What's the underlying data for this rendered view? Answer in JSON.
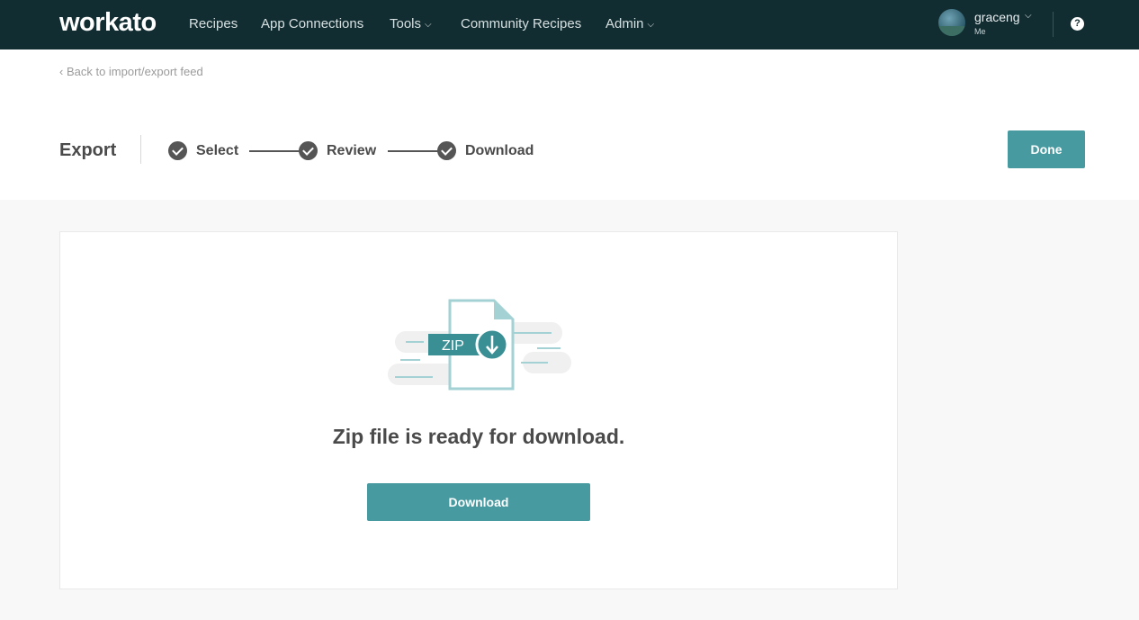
{
  "nav": {
    "logo": "workato",
    "items": [
      {
        "label": "Recipes"
      },
      {
        "label": "App Connections"
      },
      {
        "label": "Tools",
        "has_menu": true
      },
      {
        "label": "Community Recipes"
      },
      {
        "label": "Admin",
        "has_menu": true
      }
    ],
    "user": {
      "name": "graceng",
      "sub": "Me"
    },
    "help_glyph": "?",
    "icons": {
      "dropdown": "chevron-down-icon",
      "help": "help-icon"
    }
  },
  "header": {
    "back_link": "‹ Back to import/export feed",
    "title": "Export",
    "steps": [
      {
        "label": "Select",
        "status": "complete"
      },
      {
        "label": "Review",
        "status": "complete"
      },
      {
        "label": "Download",
        "status": "complete"
      }
    ],
    "done_label": "Done"
  },
  "card": {
    "file_badge": "ZIP",
    "message": "Zip file is ready for download.",
    "download_label": "Download"
  },
  "colors": {
    "nav_bg": "#122d31",
    "accent": "#469aa0",
    "step_icon": "#555555",
    "illustration_light": "#a3d1d4",
    "illustration_dark": "#3a8f95"
  }
}
